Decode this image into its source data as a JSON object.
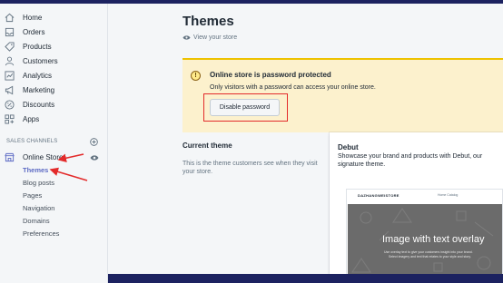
{
  "sidebar": {
    "items": [
      {
        "label": "Home",
        "icon": "home-icon"
      },
      {
        "label": "Orders",
        "icon": "orders-icon"
      },
      {
        "label": "Products",
        "icon": "tag-icon"
      },
      {
        "label": "Customers",
        "icon": "person-icon"
      },
      {
        "label": "Analytics",
        "icon": "analytics-icon"
      },
      {
        "label": "Marketing",
        "icon": "megaphone-icon"
      },
      {
        "label": "Discounts",
        "icon": "discount-icon"
      },
      {
        "label": "Apps",
        "icon": "apps-icon"
      }
    ],
    "section_label": "SALES CHANNELS",
    "online_store": "Online Store",
    "sub_items": [
      "Themes",
      "Blog posts",
      "Pages",
      "Navigation",
      "Domains",
      "Preferences"
    ]
  },
  "main": {
    "title": "Themes",
    "view_store": "View your store",
    "banner": {
      "title": "Online store is password protected",
      "text": "Only visitors with a password can access your online store.",
      "button": "Disable password"
    },
    "current_theme": {
      "title": "Current theme",
      "desc": "This is the theme customers see when they visit your store."
    },
    "card": {
      "title": "Debut",
      "desc": "Showcase your brand and products with Debut, our signature theme.",
      "preview_brand": "DAZHANGWEISTORE",
      "preview_links": "Home   Catalog",
      "hero_title": "Image with text overlay",
      "hero_sub": "Use overlay text to give your customers insight into your brand.",
      "hero_sub2": "Select imagery and text that relates to your style and story."
    }
  },
  "colors": {
    "accent": "#5c6ac4",
    "topbar": "#1c2260",
    "banner_bg": "#fcf1cd",
    "annotation_red": "#e32b2b"
  }
}
